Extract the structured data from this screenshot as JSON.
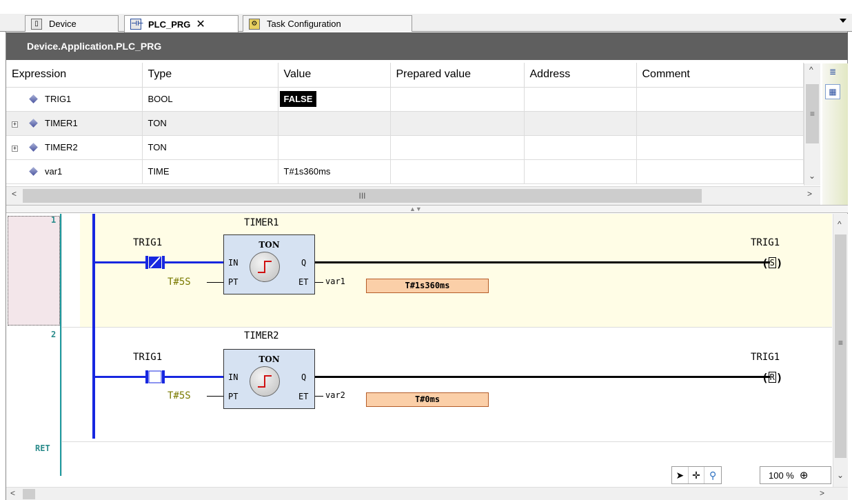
{
  "tabs": [
    {
      "label": "Device",
      "icon": "device-icon"
    },
    {
      "label": "PLC_PRG",
      "icon": "ladder-pou-icon",
      "active": true,
      "close": "✕"
    },
    {
      "label": "Task Configuration",
      "icon": "task-config-icon"
    }
  ],
  "path": "Device.Application.PLC_PRG",
  "table": {
    "headers": [
      "Expression",
      "Type",
      "Value",
      "Prepared value",
      "Address",
      "Comment"
    ],
    "rows": [
      {
        "expression": "TRIG1",
        "type": "BOOL",
        "value": "FALSE",
        "expandable": false
      },
      {
        "expression": "TIMER1",
        "type": "TON",
        "value": "",
        "expandable": true
      },
      {
        "expression": "TIMER2",
        "type": "TON",
        "value": "",
        "expandable": true
      },
      {
        "expression": "var1",
        "type": "TIME",
        "value": "T#1s360ms",
        "expandable": false
      }
    ]
  },
  "ladder": {
    "rungs": [
      {
        "number": "1",
        "instance": "TIMER1",
        "block": "TON",
        "contact": "TRIG1",
        "pt_value": "T#5S",
        "pin_in": "IN",
        "pin_pt": "PT",
        "pin_q": "Q",
        "pin_et": "ET",
        "et_var": "var1",
        "et_value": "T#1s360ms",
        "coil": "TRIG1",
        "coil_type": "S"
      },
      {
        "number": "2",
        "instance": "TIMER2",
        "block": "TON",
        "contact": "TRIG1",
        "pt_value": "T#5S",
        "pin_in": "IN",
        "pin_pt": "PT",
        "pin_q": "Q",
        "pin_et": "ET",
        "et_var": "var2",
        "et_value": "T#0ms",
        "coil": "TRIG1",
        "coil_type": "R"
      }
    ],
    "ret_label": "RET"
  },
  "zoom": {
    "level": "100 %"
  },
  "scroll_grip": "III",
  "scroll_grip_v": "≡"
}
